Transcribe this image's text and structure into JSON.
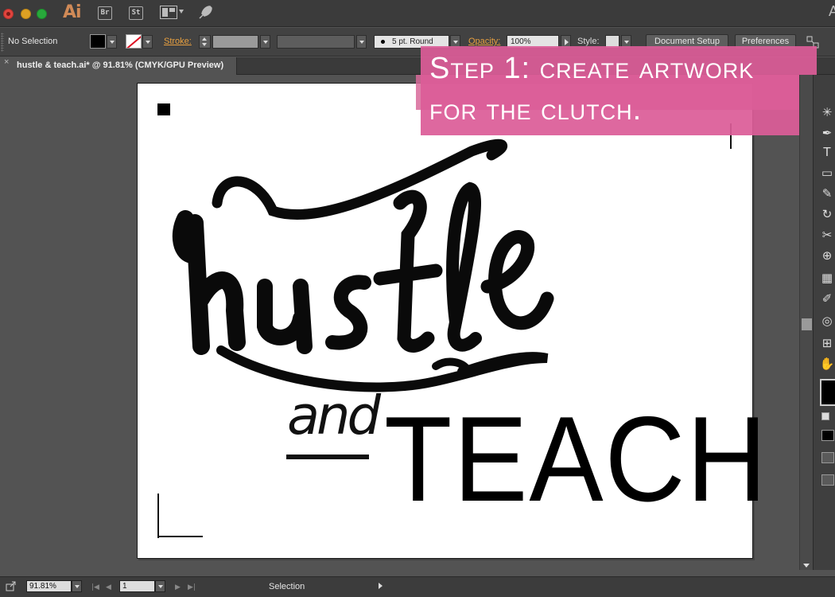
{
  "titlebar": {
    "app_logo": "Ai",
    "bridge_label": "Br",
    "stock_label": "St",
    "right_glyph": "A"
  },
  "controlbar": {
    "selection_status": "No Selection",
    "stroke_label": "Stroke:",
    "brush_value": "5 pt. Round",
    "opacity_label": "Opacity:",
    "opacity_value": "100%",
    "style_label": "Style:",
    "document_setup_label": "Document Setup",
    "preferences_label": "Preferences"
  },
  "tab": {
    "close_glyph": "×",
    "title": "hustle & teach.ai* @ 91.81% (CMYK/GPU Preview)"
  },
  "artwork": {
    "script_word": "hustle",
    "and_word": "and",
    "teach_word": "TEACH"
  },
  "callout": {
    "line1": "Step 1: create artwork",
    "line2": "for the clutch."
  },
  "statusbar": {
    "zoom_value": "91.81%",
    "page_value": "1",
    "current_tool": "Selection"
  },
  "colors": {
    "callout_pink": "#dc5c98",
    "stroke_orange": "#e8a040",
    "ui_dark": "#535353"
  },
  "icons": {
    "toolbox": [
      "selection-tool-icon",
      "pen-tool-icon",
      "type-tool-icon",
      "rectangle-tool-icon",
      "paintbrush-tool-icon",
      "rotate-tool-icon",
      "scale-tool-icon",
      "shape-builder-icon",
      "chart-tool-icon",
      "eyedropper-tool-icon",
      "blend-tool-icon",
      "artboard-tool-icon",
      "hand-tool-icon"
    ]
  }
}
